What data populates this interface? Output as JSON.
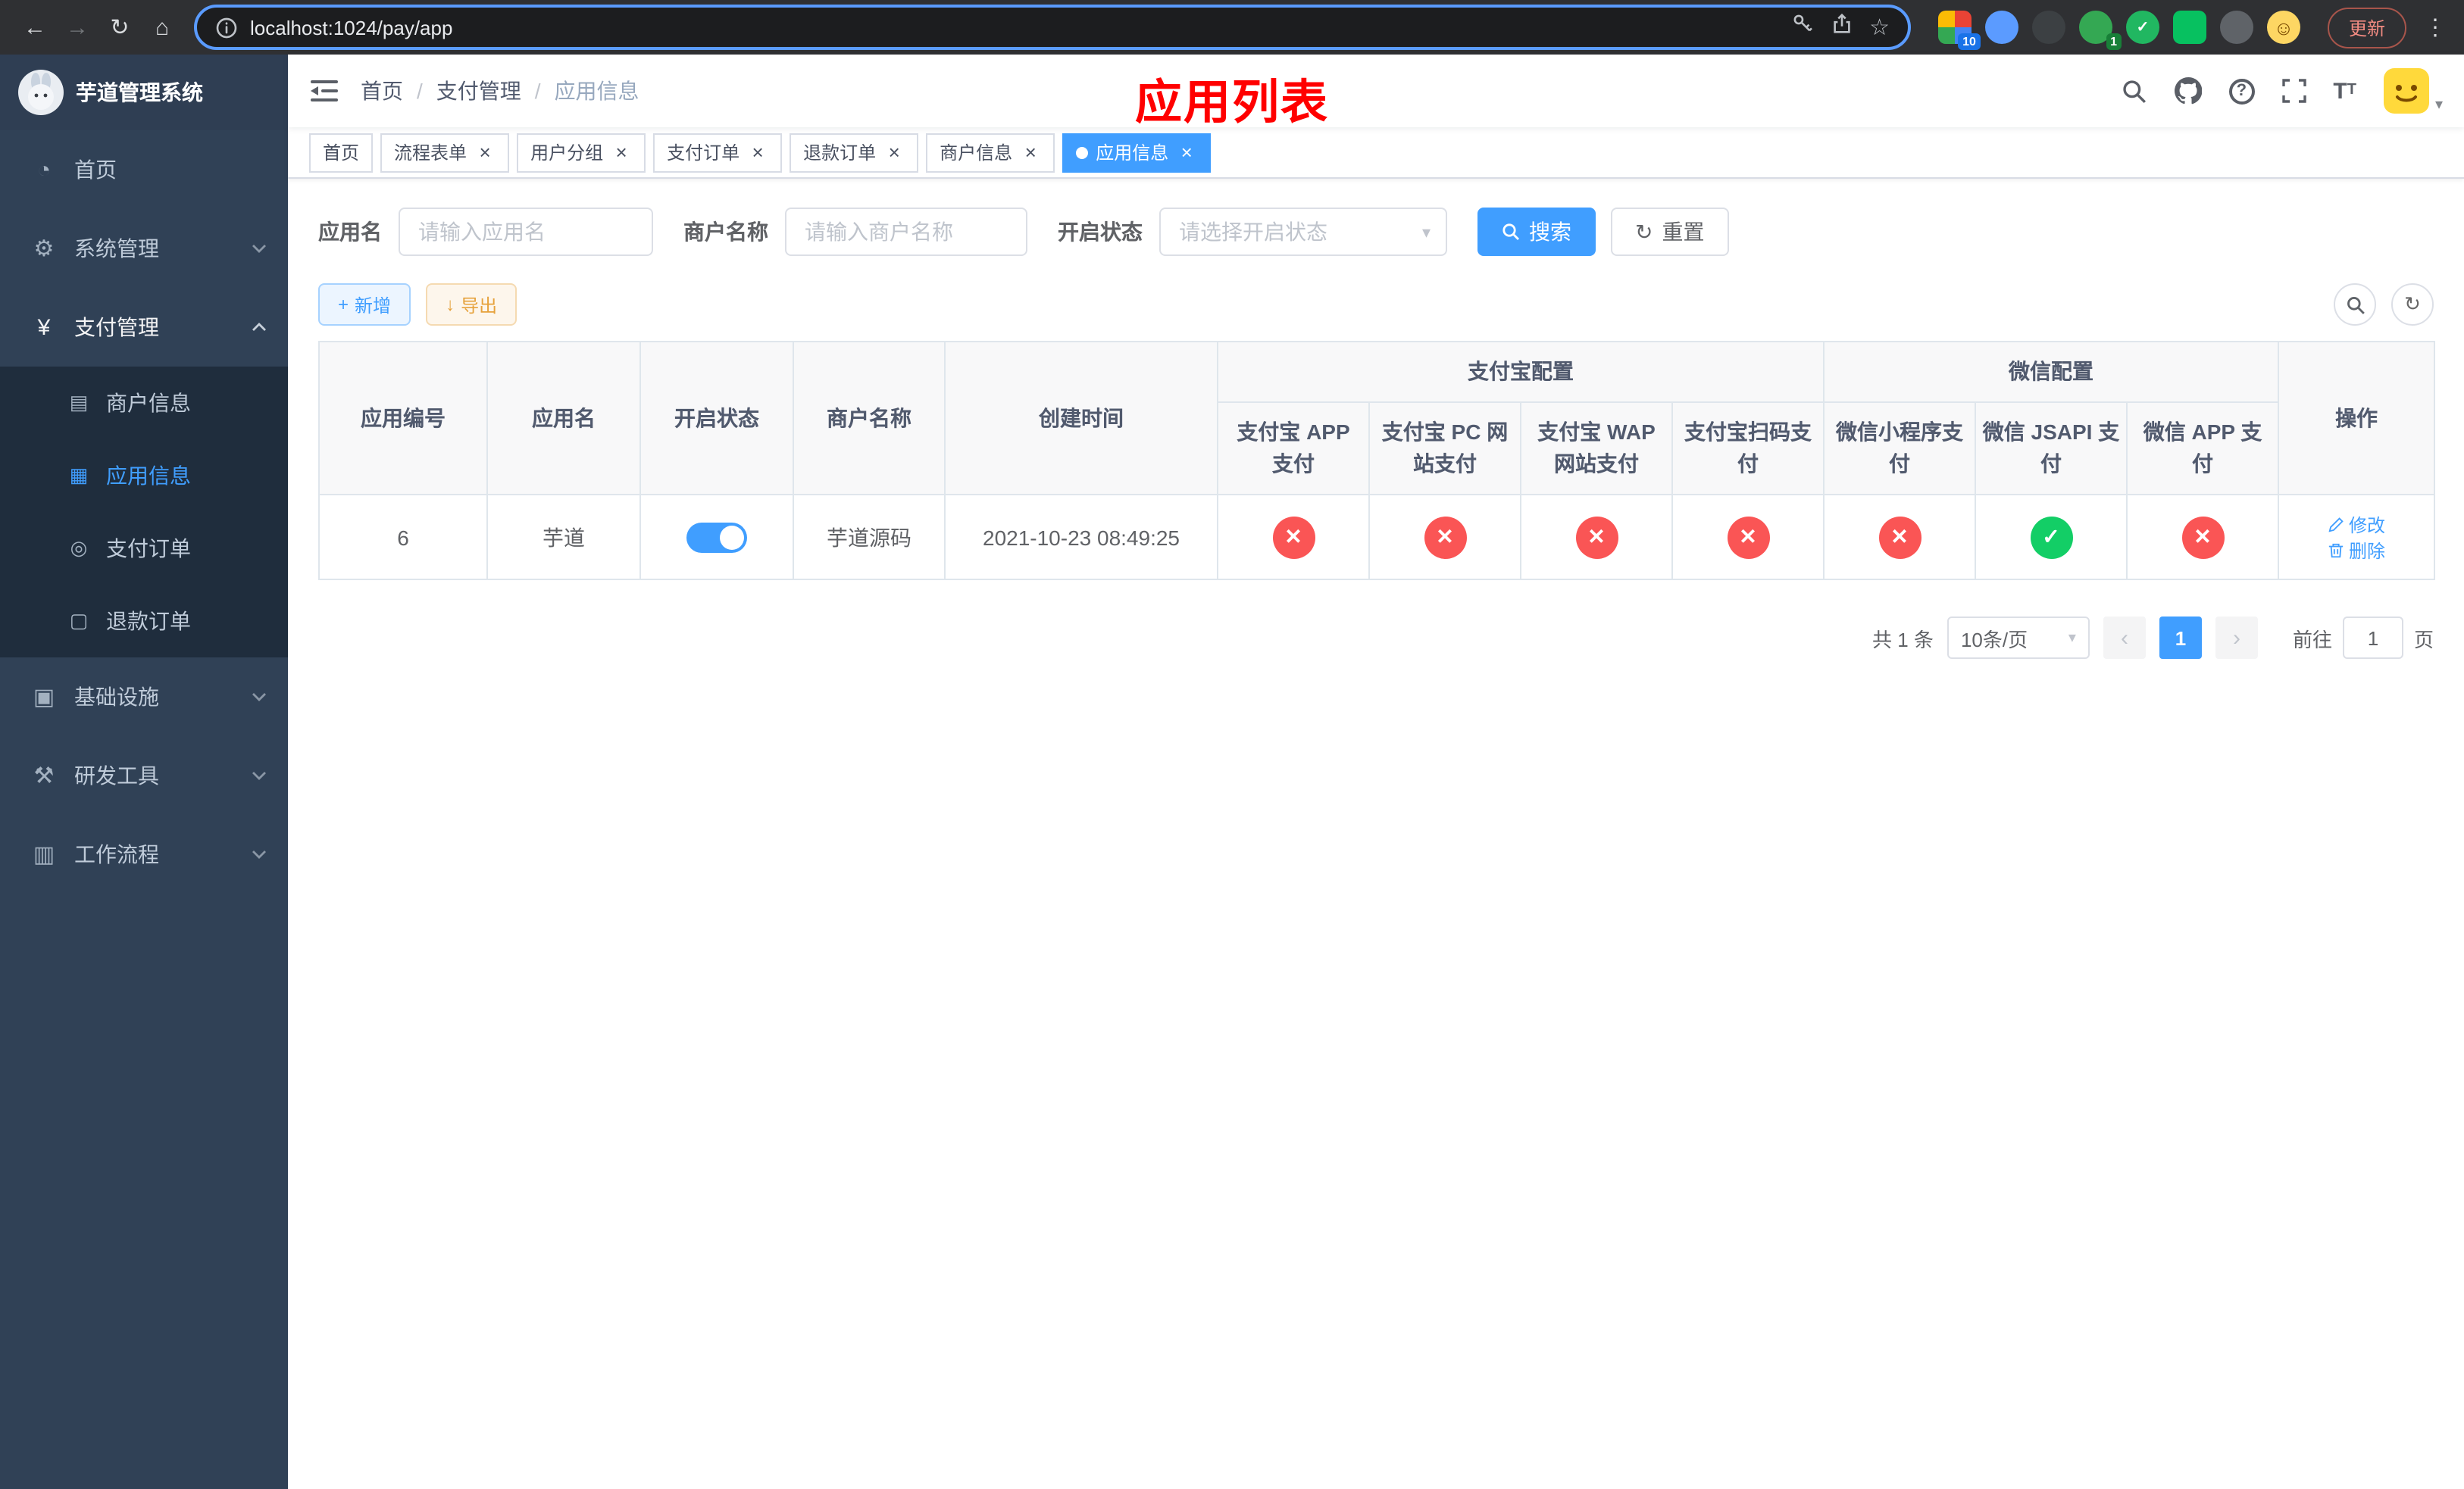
{
  "browser": {
    "url": "localhost:1024/pay/app",
    "update_label": "更新",
    "ext_badge_a": "10",
    "ext_badge_b": "1"
  },
  "annotation": "应用列表",
  "icons": {
    "back": "←",
    "forward": "→",
    "reload": "↻",
    "home": "⌂",
    "bookmark": "☆",
    "more": "⋮",
    "caret_down": "▾",
    "close": "×",
    "check": "✓",
    "cross": "✕",
    "plus": "+",
    "download": "↓",
    "refresh": "↻",
    "breadcrumb_sep": "/",
    "font_big": "T",
    "font_small": "T",
    "smile": "☺",
    "chevron_left": "‹",
    "chevron_right": "›",
    "check_mark": "✓",
    "question": "?"
  },
  "sidebar": {
    "app_title": "芋道管理系统",
    "menu": [
      {
        "label": "首页",
        "icon": "◔"
      },
      {
        "label": "系统管理",
        "icon": "⚙"
      },
      {
        "label": "支付管理",
        "icon": "¥"
      },
      {
        "label": "基础设施",
        "icon": "▣"
      },
      {
        "label": "研发工具",
        "icon": "⚒"
      },
      {
        "label": "工作流程",
        "icon": "▥"
      }
    ],
    "submenu": [
      {
        "label": "商户信息",
        "icon": "▤"
      },
      {
        "label": "应用信息",
        "icon": "▦"
      },
      {
        "label": "支付订单",
        "icon": "◎"
      },
      {
        "label": "退款订单",
        "icon": "▢"
      }
    ]
  },
  "navbar": {
    "breadcrumb": [
      "首页",
      "支付管理",
      "应用信息"
    ]
  },
  "tabs": [
    {
      "label": "首页"
    },
    {
      "label": "流程表单"
    },
    {
      "label": "用户分组"
    },
    {
      "label": "支付订单"
    },
    {
      "label": "退款订单"
    },
    {
      "label": "商户信息"
    },
    {
      "label": "应用信息"
    }
  ],
  "filters": {
    "app_name": {
      "label": "应用名",
      "placeholder": "请输入应用名",
      "value": ""
    },
    "merchant_name": {
      "label": "商户名称",
      "placeholder": "请输入商户名称",
      "value": ""
    },
    "status": {
      "label": "开启状态",
      "placeholder": "请选择开启状态",
      "value": ""
    },
    "search": "搜索",
    "reset": "重置"
  },
  "toolbar": {
    "add": "新增",
    "export": "导出"
  },
  "table": {
    "groups": {
      "alipay": "支付宝配置",
      "wechat": "微信配置"
    },
    "columns": {
      "id": "应用编号",
      "name": "应用名",
      "status": "开启状态",
      "merchant": "商户名称",
      "created": "创建时间",
      "alipay_app": "支付宝 APP 支付",
      "alipay_pc": "支付宝 PC 网站支付",
      "alipay_wap": "支付宝 WAP 网站支付",
      "alipay_qr": "支付宝扫码支付",
      "wx_mini": "微信小程序支付",
      "wx_jsapi": "微信 JSAPI 支付",
      "wx_app": "微信 APP 支付",
      "actions": "操作"
    },
    "rows": [
      {
        "id": "6",
        "name": "芋道",
        "enabled": true,
        "merchant": "芋道源码",
        "created": "2021-10-23 08:49:25",
        "alipay_app": "fail",
        "alipay_pc": "fail",
        "alipay_wap": "fail",
        "alipay_qr": "fail",
        "wx_mini": "fail",
        "wx_jsapi": "success",
        "wx_app": "fail",
        "edit": "修改",
        "delete": "删除"
      }
    ]
  },
  "pagination": {
    "total": "共 1 条",
    "page_size": "10条/页",
    "current": "1",
    "goto": "前往",
    "goto_value": "1",
    "unit": "页"
  }
}
